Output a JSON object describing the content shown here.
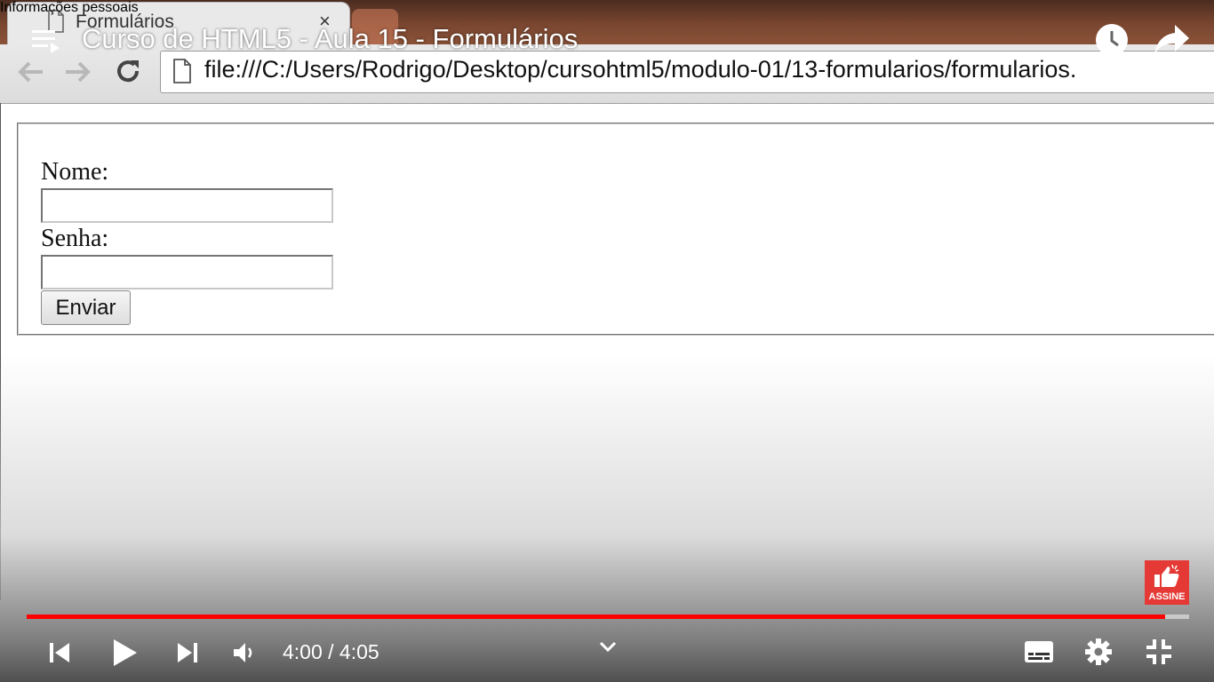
{
  "browser": {
    "tab_title": "Formulários",
    "tab_close": "×",
    "url": "file:///C:/Users/Rodrigo/Desktop/cursohtml5/modulo-01/13-formularios/formularios."
  },
  "form": {
    "legend": "Informações pessoais",
    "name_label": "Nome:",
    "name_value": "",
    "password_label": "Senha:",
    "password_value": "",
    "submit_label": "Enviar"
  },
  "player": {
    "title": "Curso de HTML5 - Aula 15 - Formulários",
    "time_display": "4:00 / 4:05",
    "progress_fraction": 0.9796,
    "subscribe_label": "ASSINE",
    "accent_color": "#ff0000"
  },
  "icons": {
    "playlist": "playlist-icon",
    "watch_later": "clock-icon",
    "share": "share-icon",
    "previous": "skip-previous-icon",
    "play": "play-icon",
    "next": "skip-next-icon",
    "volume": "volume-icon",
    "chevron": "chevron-down-icon",
    "subtitles": "subtitles-icon",
    "settings": "gear-icon",
    "exit_fullscreen": "exit-fullscreen-icon"
  }
}
